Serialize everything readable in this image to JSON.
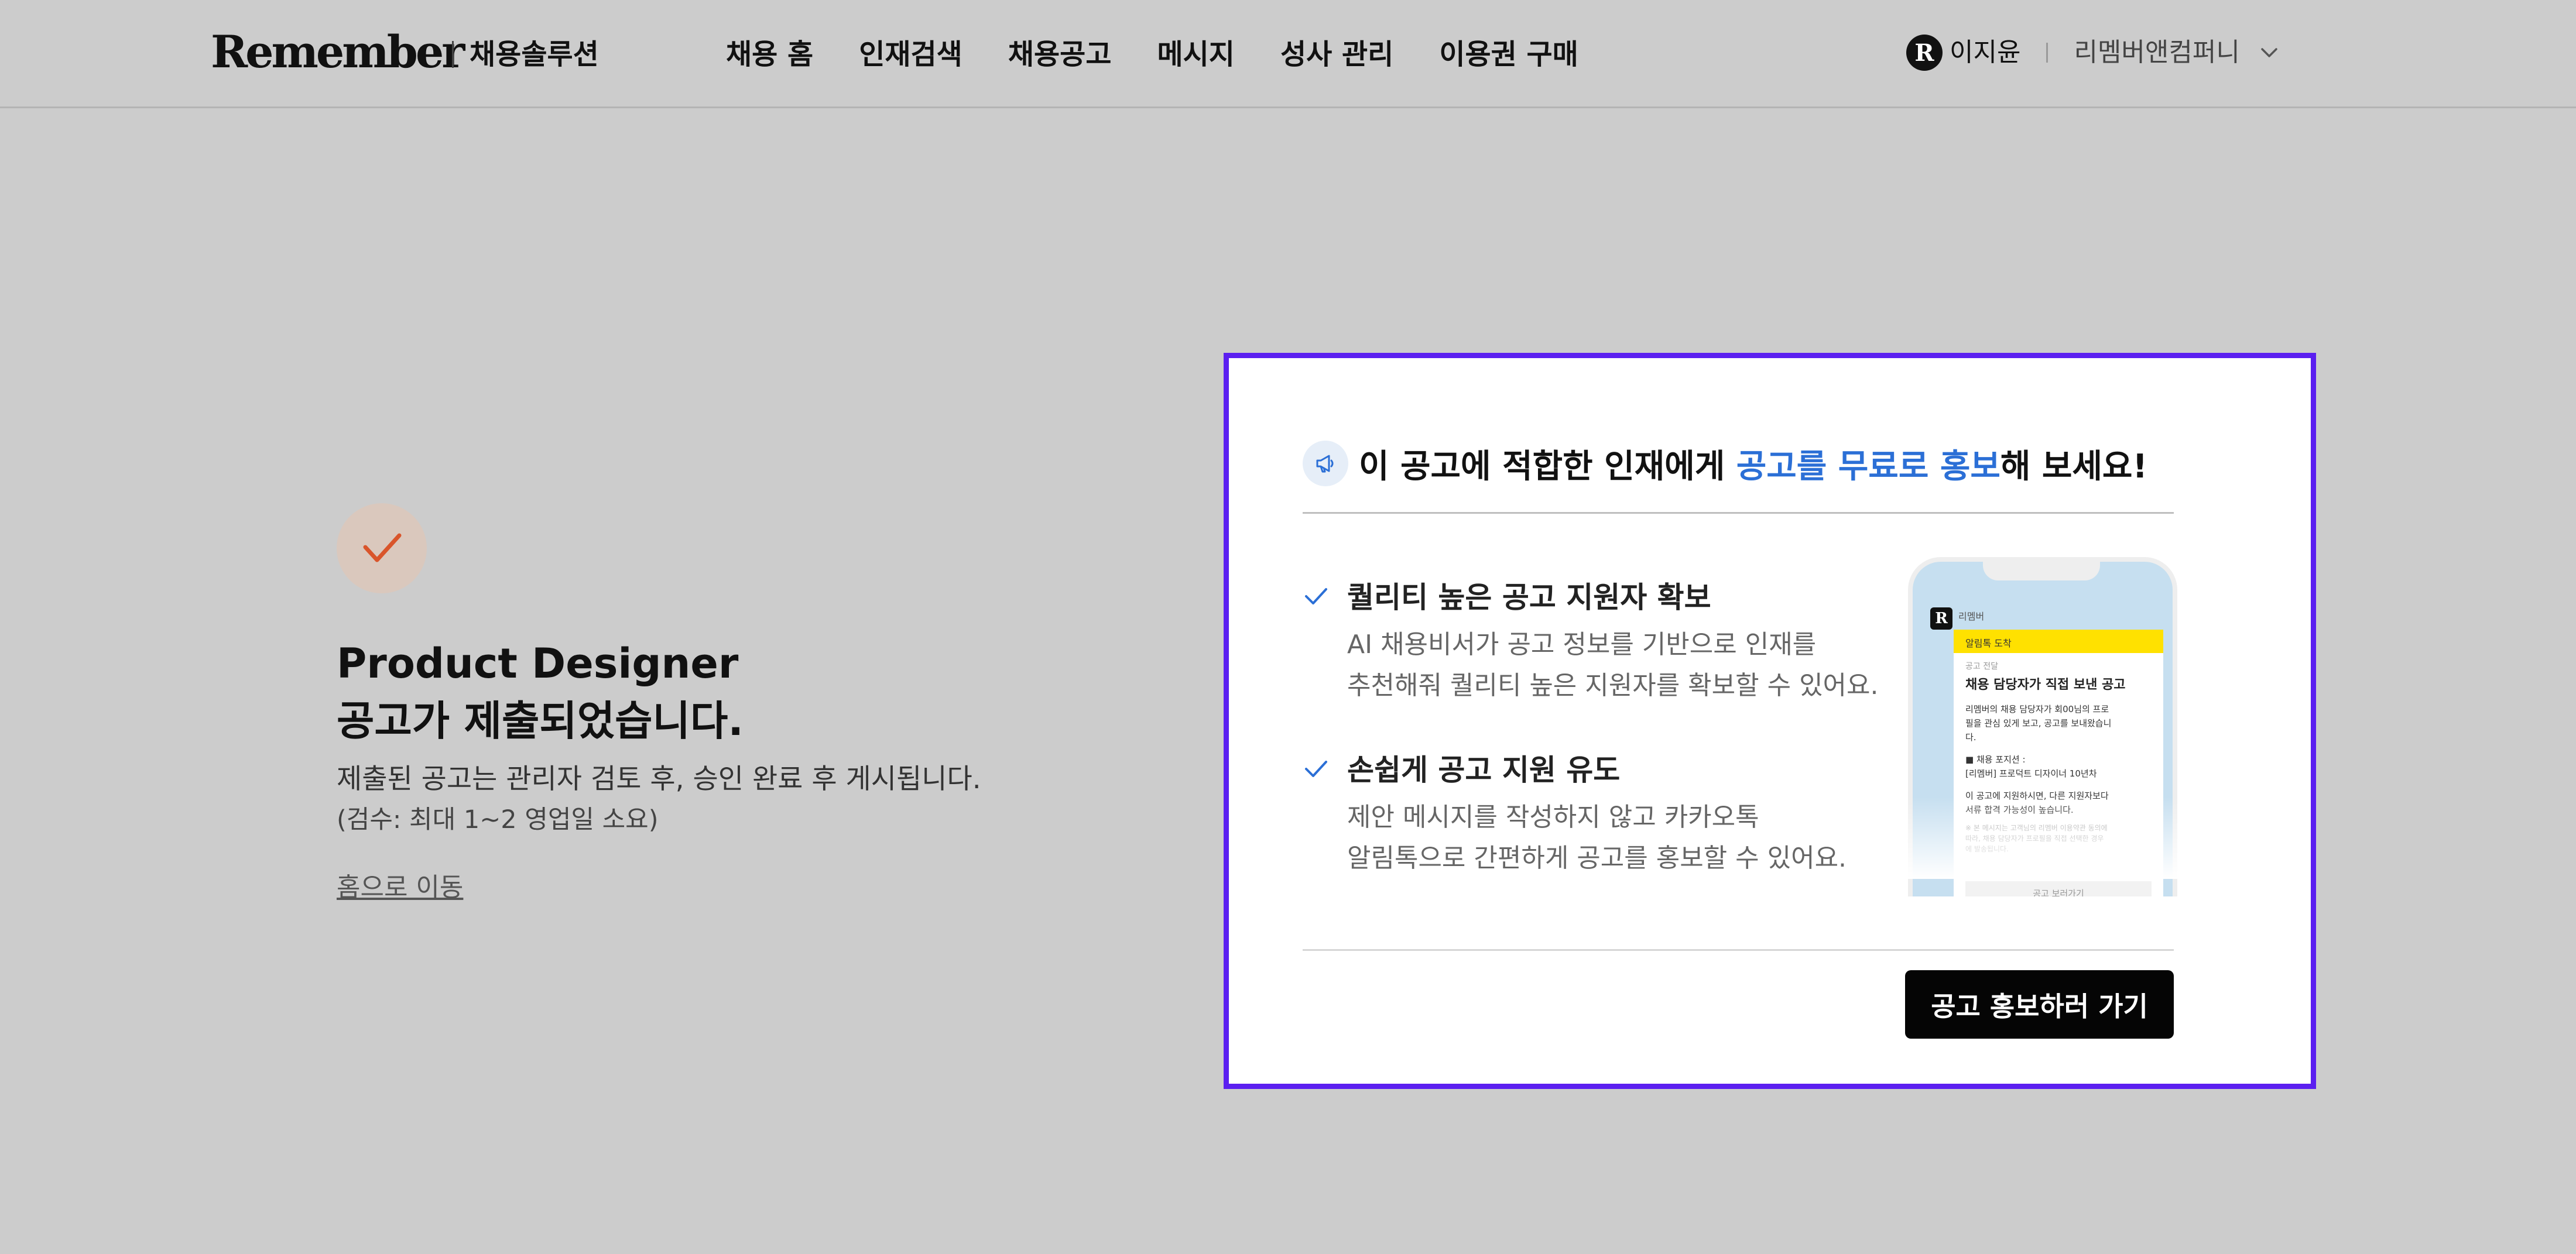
{
  "header": {
    "logo": "Remember",
    "logo_sub": "채용솔루션",
    "nav": [
      "채용 홈",
      "인재검색",
      "채용공고",
      "메시지",
      "성사 관리",
      "이용권 구매"
    ],
    "user": {
      "avatar_letter": "R",
      "name": "이지윤",
      "company": "리멤버앤컴퍼니"
    }
  },
  "result": {
    "title_line1": "Product Designer",
    "title_line2": "공고가 제출되었습니다.",
    "description": "제출된 공고는 관리자 검토 후, 승인 완료 후 게시됩니다.",
    "note": "(검수: 최대 1~2 영업일 소요)",
    "home_link": "홈으로 이동"
  },
  "promo": {
    "headline_prefix": "이 공고에 적합한 인재에게 ",
    "headline_highlight": "공고를 무료로 홍보",
    "headline_suffix": "해 보세요!",
    "features": [
      {
        "title": "퀄리티 높은 공고 지원자 확보",
        "line1": "AI 채용비서가 공고 정보를 기반으로 인재를",
        "line2": "추천해줘 퀄리티 높은 지원자를 확보할 수 있어요."
      },
      {
        "title": "손쉽게 공고 지원 유도",
        "line1": "제안 메시지를 작성하지 않고 카카오톡",
        "line2": "알림톡으로 간편하게 공고를 홍보할 수 있어요."
      }
    ],
    "cta": "공고 홍보하러 가기",
    "phone": {
      "logo_letter": "R",
      "brand": "리멤버",
      "banner": "알림톡 도착",
      "label": "공고 전달",
      "title": "채용 담당자가 직접 보낸 공고",
      "body1": "리멤버의 채용 담당자가 회00님의 프로",
      "body2": "필을 관심 있게 보고, 공고를 보내왔습니",
      "body3": "다.",
      "pos_label": "■ 채용 포지션 :",
      "pos_value": "[리멤버] 프로덕트 디자이너 10년차",
      "note1": "이 공고에 지원하시면, 다른 지원자보다",
      "note2": "서류 합격 가능성이 높습니다.",
      "muted1": "※ 본 메시지는 고객님의 리멤버 이용약관 동의에",
      "muted2": "따라, 채용 담당자가 프로필을 직접 선택한 경우",
      "muted3": "에 발송됩니다.",
      "button": "공고 보러가기"
    }
  }
}
